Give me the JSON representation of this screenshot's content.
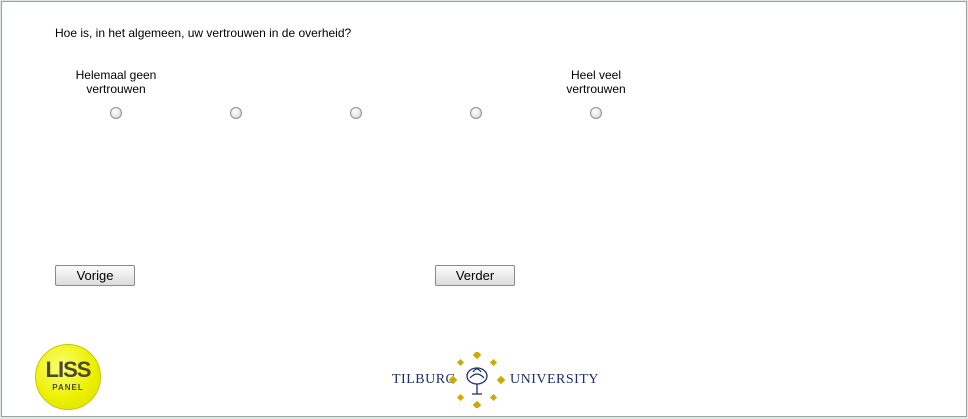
{
  "question": "Hoe is, in het algemeen, uw vertrouwen in de overheid?",
  "scale": {
    "left_anchor": [
      "Helemaal geen",
      "vertrouwen"
    ],
    "right_anchor": [
      "Heel veel",
      "vertrouwen"
    ],
    "options_count": 5,
    "selected": null
  },
  "buttons": {
    "prev_label": "Vorige",
    "next_label": "Verder"
  },
  "logos": {
    "liss_main": "LISS",
    "liss_sub": "PANEL",
    "tilburg_left": "TILBURG",
    "tilburg_right": "UNIVERSITY"
  },
  "colors": {
    "liss_yellow": "#eef000",
    "tilburg_gold": "#d2a800",
    "tilburg_blue": "#1c2f6b"
  }
}
